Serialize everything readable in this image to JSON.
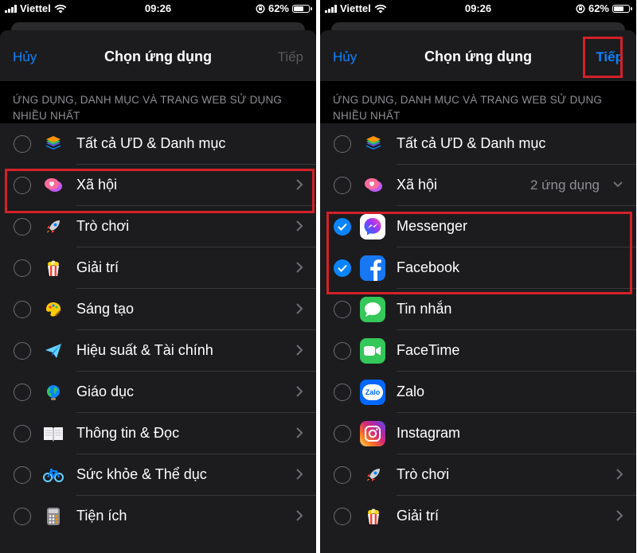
{
  "status": {
    "carrier": "Viettel",
    "time": "09:26",
    "battery": "62%"
  },
  "left": {
    "nav": {
      "cancel": "Hủy",
      "title": "Chọn ứng dụng",
      "next": "Tiếp"
    },
    "section_header": "ỨNG DỤNG, DANH MỤC VÀ TRANG WEB SỬ DỤNG NHIỀU NHẤT",
    "rows": [
      {
        "label": "Tất cả ƯD & Danh mục",
        "icon": "stack-layers-icon"
      },
      {
        "label": "Xã hội",
        "icon": "social-chat-icon"
      },
      {
        "label": "Trò chơi",
        "icon": "rocket-icon"
      },
      {
        "label": "Giải trí",
        "icon": "popcorn-icon"
      },
      {
        "label": "Sáng tạo",
        "icon": "palette-icon"
      },
      {
        "label": "Hiệu suất & Tài chính",
        "icon": "paper-plane-icon"
      },
      {
        "label": "Giáo dục",
        "icon": "globe-icon"
      },
      {
        "label": "Thông tin & Đọc",
        "icon": "book-icon"
      },
      {
        "label": "Sức khỏe & Thể dục",
        "icon": "bicycle-icon"
      },
      {
        "label": "Tiện ích",
        "icon": "calculator-icon"
      }
    ]
  },
  "right": {
    "nav": {
      "cancel": "Hủy",
      "title": "Chọn ứng dụng",
      "next": "Tiếp"
    },
    "section_header": "ỨNG DỤNG, DANH MỤC VÀ TRANG WEB SỬ DỤNG NHIỀU NHẤT",
    "rows": [
      {
        "label": "Tất cả ƯD & Danh mục",
        "icon": "stack-layers-icon"
      },
      {
        "label": "Xã hội",
        "icon": "social-chat-icon",
        "detail": "2 ứng dụng"
      },
      {
        "label": "Messenger",
        "icon": "messenger-icon",
        "checked": true
      },
      {
        "label": "Facebook",
        "icon": "facebook-icon",
        "checked": true
      },
      {
        "label": "Tin nhắn",
        "icon": "messages-icon"
      },
      {
        "label": "FaceTime",
        "icon": "facetime-icon"
      },
      {
        "label": "Zalo",
        "icon": "zalo-icon",
        "icon_text": "Zalo"
      },
      {
        "label": "Instagram",
        "icon": "instagram-icon"
      },
      {
        "label": "Trò chơi",
        "icon": "rocket-icon"
      },
      {
        "label": "Giải trí",
        "icon": "popcorn-icon"
      }
    ]
  },
  "colors": {
    "accent": "#0a84ff",
    "highlight": "#d42128",
    "sheet": "#1c1c1e",
    "separator": "#38383a"
  }
}
